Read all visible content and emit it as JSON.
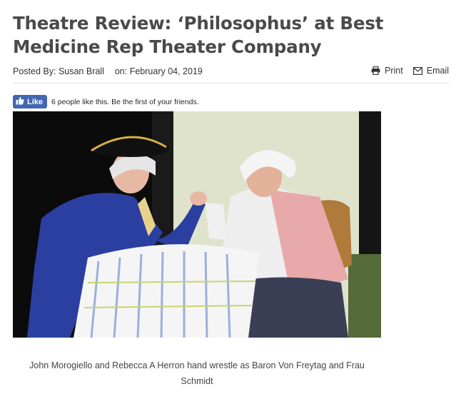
{
  "article": {
    "title": "Theatre Review: ‘Philosophus’ at Best Medicine Rep Theater Company",
    "posted_by_label": "Posted By:",
    "author": "Susan Brall",
    "on_label": "on:",
    "date": "February 04, 2019"
  },
  "actions": {
    "print_label": "Print",
    "email_label": "Email",
    "print_icon": "printer-icon",
    "email_icon": "envelope-icon"
  },
  "social": {
    "like_label": "Like",
    "like_text": "6 people like this. Be the first of your friends.",
    "like_icon": "thumbs-up-icon",
    "brand_color": "#4267b2"
  },
  "photo": {
    "caption": "John Morogiello and Rebecca A Herron hand wrestle as Baron Von Freytag and Frau Schmidt"
  },
  "colors": {
    "title": "#4a4a4a",
    "divider": "#e3e3e3"
  }
}
